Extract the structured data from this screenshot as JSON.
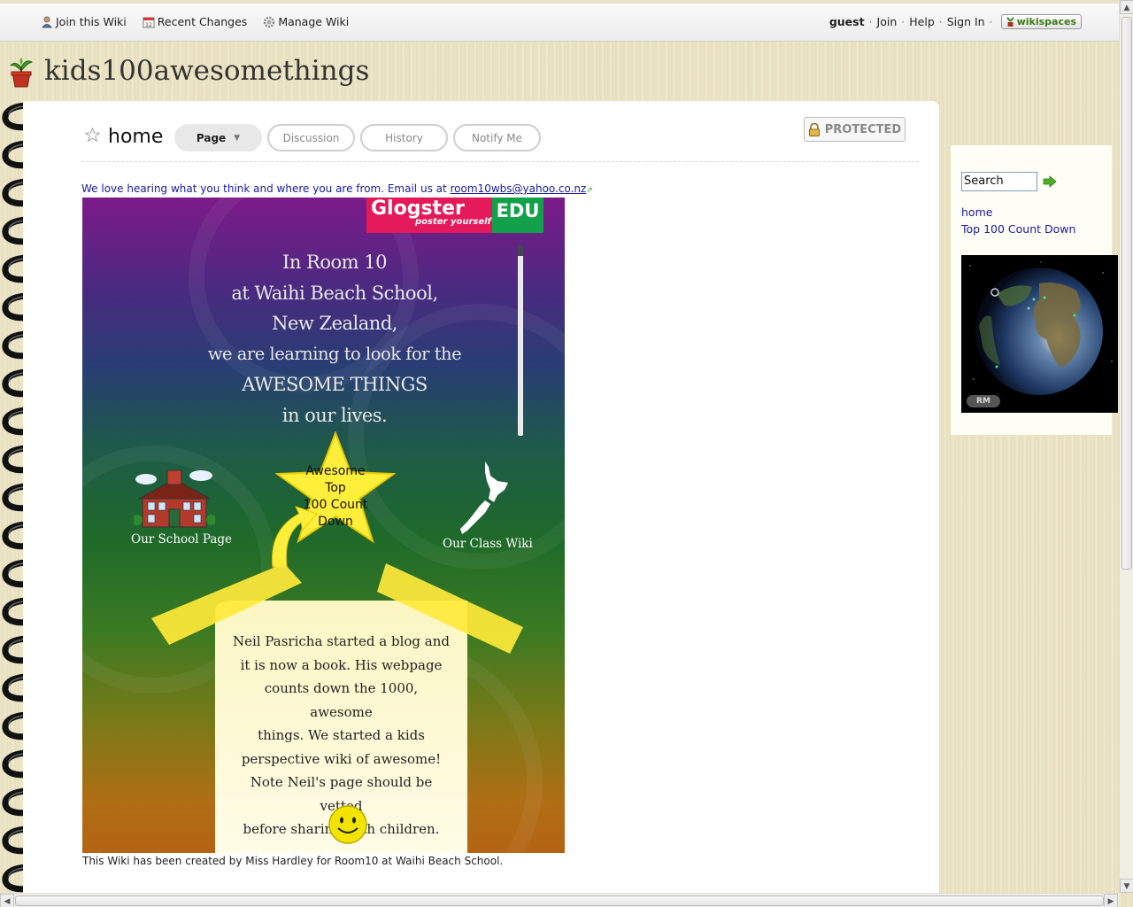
{
  "topnav": {
    "join_wiki": "Join this Wiki",
    "recent_changes": "Recent Changes",
    "manage_wiki": "Manage Wiki",
    "user": "guest",
    "join": "Join",
    "help": "Help",
    "sign_in": "Sign In",
    "brand": "wikispaces"
  },
  "site": {
    "title": "kids100awesomethings"
  },
  "page": {
    "name": "home",
    "tabs": [
      {
        "label": "Page"
      },
      {
        "label": "Discussion"
      },
      {
        "label": "History"
      },
      {
        "label": "Notify Me"
      }
    ],
    "protected_label": "PROTECTED",
    "intro_text": "We love hearing what you think and where you are from. Email us at ",
    "intro_email": "room10wbs@yahoo.co.nz",
    "footer": "This Wiki has been created by Miss Hardley for Room10 at Waihi Beach School."
  },
  "poster": {
    "brand_main": "Glogster",
    "brand_sub": "poster yourself",
    "brand_edu": "EDU",
    "lines": [
      "In Room 10",
      "at Waihi Beach School,",
      "New Zealand,",
      "we are learning to look for the",
      "AWESOME THINGS",
      "in our lives."
    ],
    "star_lines": [
      "Awesome",
      "Top",
      "100 Count",
      "Down"
    ],
    "school_label": "Our School Page",
    "class_label": "Our Class Wiki",
    "scroll_lines": [
      "Neil Pasricha started a blog and",
      "it is now a book. His webpage",
      "counts down the 1000, awesome",
      "things. We started a kids",
      "perspective wiki of awesome!",
      "Note Neil's page should be vetted",
      "before sharing with children."
    ]
  },
  "sidebar": {
    "search_value": "Search",
    "links": [
      {
        "label": "home"
      },
      {
        "label": "Top 100 Count Down"
      }
    ],
    "globe_badge": "RM"
  },
  "colors": {
    "link": "#1a1a99",
    "glogster_pink": "#e3195a",
    "edu_green": "#12a04a"
  }
}
